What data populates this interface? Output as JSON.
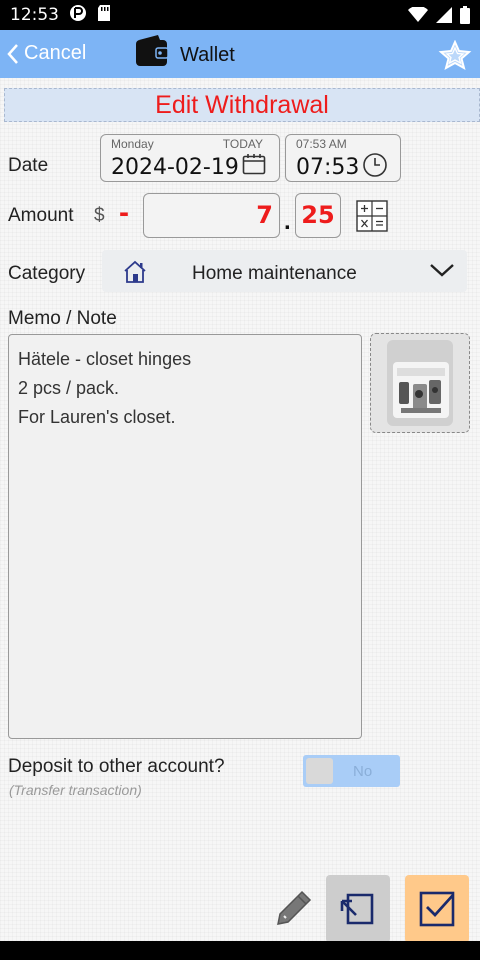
{
  "status_bar": {
    "time": "12:53"
  },
  "header": {
    "cancel_label": "Cancel",
    "title": "Wallet"
  },
  "form_title": "Edit Withdrawal",
  "date": {
    "label": "Date",
    "weekday": "Monday",
    "today_label": "TODAY",
    "value": "2024-02-19",
    "time_small": "07:53 AM",
    "time_value": "07:53"
  },
  "amount": {
    "label": "Amount",
    "currency": "$",
    "sign": "-",
    "integer": "7",
    "separator": ".",
    "decimal": "25"
  },
  "category": {
    "label": "Category",
    "value": "Home maintenance",
    "icon": "house-icon"
  },
  "memo": {
    "label": "Memo / Note",
    "lines": [
      "Hätele - closet hinges",
      "2 pcs / pack.",
      "For Lauren's closet."
    ]
  },
  "deposit": {
    "label": "Deposit to other account?",
    "sublabel": "(Transfer transaction)",
    "toggle_value": "No"
  },
  "colors": {
    "header_bg": "#7db4f5",
    "accent_red": "#ee1c1c",
    "save_bg": "#ffc98a",
    "revert_bg": "#cdcdcd"
  }
}
